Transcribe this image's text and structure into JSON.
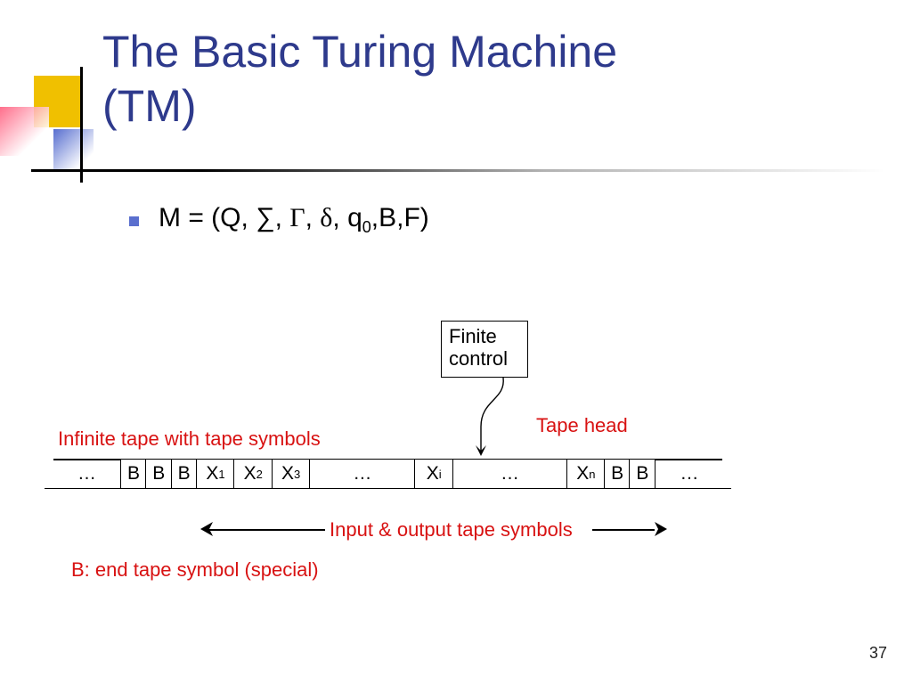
{
  "title_line1": "The Basic Turing Machine",
  "title_line2": "(TM)",
  "tuple": {
    "prefix": "M = (Q, ",
    "sigma": "∑",
    "gamma": "Γ",
    "delta": "δ",
    "q": "q",
    "q_sub": "0",
    "suffix": ",B,F)"
  },
  "finite_control": "Finite control",
  "tape_head": "Tape head",
  "infinite_label": "Infinite tape with tape symbols",
  "io_label": "Input & output tape symbols",
  "b_label": "B: end tape symbol (special)",
  "page": "37",
  "tape": {
    "left_ellipsis": "…",
    "cells": [
      {
        "t": "B",
        "s": ""
      },
      {
        "t": "B",
        "s": ""
      },
      {
        "t": "B",
        "s": ""
      },
      {
        "t": "X",
        "s": "1"
      },
      {
        "t": "X",
        "s": "2"
      },
      {
        "t": "X",
        "s": "3"
      },
      {
        "t": "…",
        "s": ""
      },
      {
        "t": "X",
        "s": "i"
      },
      {
        "t": "…",
        "s": ""
      },
      {
        "t": "X",
        "s": "n"
      },
      {
        "t": "B",
        "s": ""
      },
      {
        "t": "B",
        "s": ""
      }
    ],
    "right_ellipsis": "…"
  }
}
